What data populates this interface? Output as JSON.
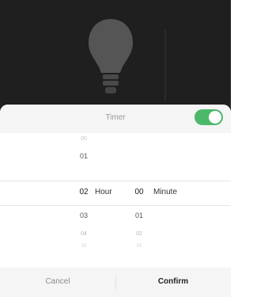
{
  "timer": {
    "title": "Timer",
    "enabled": true
  },
  "picker": {
    "hour_unit": "Hour",
    "minute_unit": "Minute",
    "hours": [
      "00",
      "01",
      "02",
      "03",
      "04",
      "05"
    ],
    "minutes": [
      "00",
      "01",
      "02",
      "03"
    ],
    "selected_hour": "02",
    "selected_minute": "00"
  },
  "footer": {
    "cancel_label": "Cancel",
    "confirm_label": "Confirm"
  },
  "colors": {
    "toggle_on": "#4cb86a",
    "backdrop": "#1f1f1f"
  }
}
